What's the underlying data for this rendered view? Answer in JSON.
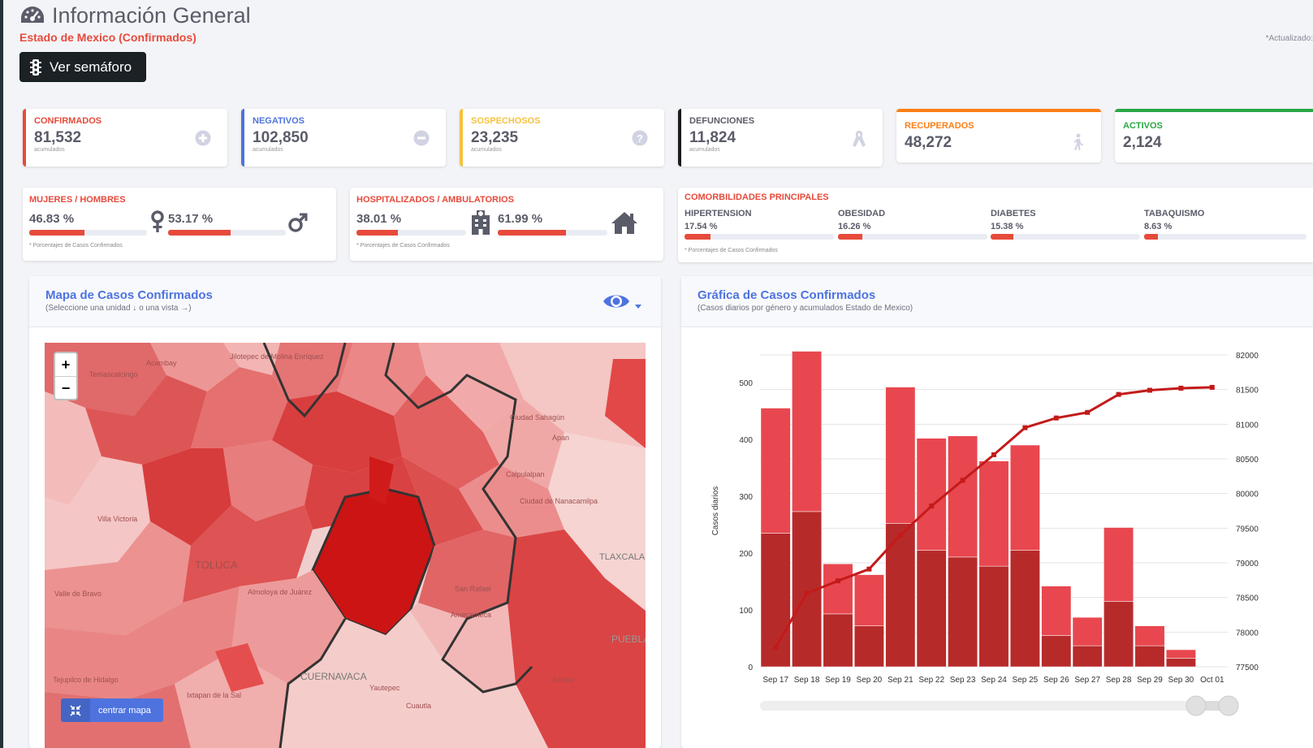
{
  "header": {
    "title": "Información General",
    "subtitle": "Estado de Mexico (Confirmados)",
    "updated_label": "*Actualizado:",
    "semaforo_button": "Ver semáforo"
  },
  "kpis": [
    {
      "label": "CONFIRMADOS",
      "value": "81,532",
      "sub": "acumulados",
      "color": "#e74a3b",
      "icon": "plus-circle-icon"
    },
    {
      "label": "NEGATIVOS",
      "value": "102,850",
      "sub": "acumulados",
      "color": "#4e73df",
      "icon": "minus-circle-icon"
    },
    {
      "label": "SOSPECHOSOS",
      "value": "23,235",
      "sub": "acumulados",
      "color": "#f6c23e",
      "icon": "question-circle-icon"
    },
    {
      "label": "DEFUNCIONES",
      "value": "11,824",
      "sub": "acumulados",
      "color": "#1b1b1b",
      "icon": "ribbon-icon"
    },
    {
      "label": "RECUPERADOS",
      "value": "48,272",
      "color": "#fd7e14",
      "icon": "walking-icon"
    },
    {
      "label": "ACTIVOS",
      "value": "2,124",
      "color": "#28a745"
    }
  ],
  "gender": {
    "title": "MUJERES / HOMBRES",
    "women_pct": "46.83 %",
    "women_fill": 0.4683,
    "men_pct": "53.17 %",
    "men_fill": 0.5317,
    "note": "* Porcentajes  de Casos Confirmados"
  },
  "hosp": {
    "title": "HOSPITALIZADOS / AMBULATORIOS",
    "hosp_pct": "38.01 %",
    "hosp_fill": 0.3801,
    "amb_pct": "61.99 %",
    "amb_fill": 0.6199,
    "note": "* Porcentajes  de Casos Confirmados"
  },
  "comorb": {
    "title": "COMORBILIDADES PRINCIPALES",
    "items": [
      {
        "label": "HIPERTENSION",
        "value": "17.54 %",
        "fill": 0.1754
      },
      {
        "label": "OBESIDAD",
        "value": "16.26 %",
        "fill": 0.1626
      },
      {
        "label": "DIABETES",
        "value": "15.38 %",
        "fill": 0.1538
      },
      {
        "label": "TABAQUISMO",
        "value": "8.63 %",
        "fill": 0.0863
      }
    ],
    "note": "* Porcentajes  de Casos Confirmados"
  },
  "map_panel": {
    "title": "Mapa de Casos Confirmados",
    "subtitle": "(Seleccione una unidad ↓ o una vista →)",
    "zoom_in": "+",
    "zoom_out": "−",
    "center_button": "centrar mapa",
    "place_labels": [
      "Acambay",
      "Jilotepec de Molina Enríquez",
      "Temascalcingo",
      "Ciudad Sahagún",
      "Apan",
      "Calpulalpan",
      "Ciudad de Nanacamilpa",
      "Villa Victoria",
      "TOLUCA",
      "TLAXCALA",
      "San Rafael",
      "Amecameca",
      "CUERNAVACA",
      "Yautepec",
      "Cuautla",
      "PUEBLA",
      "Tejupilco de Hidalgo",
      "Ixtapan de la Sal",
      "Atlixco",
      "Valle de Bravo",
      "Almoloya de Juárez"
    ]
  },
  "chart_panel": {
    "title": "Gráfica de Casos Confirmados",
    "subtitle": "(Casos diarios por género y acumulados Estado de Mexico)"
  },
  "chart_data": {
    "type": "bar",
    "categories": [
      "Sep 17",
      "Sep 18",
      "Sep 19",
      "Sep 20",
      "Sep 21",
      "Sep 22",
      "Sep 23",
      "Sep 24",
      "Sep 25",
      "Sep 26",
      "Sep 27",
      "Sep 28",
      "Sep 29",
      "Sep 30",
      "Oct 01"
    ],
    "series": [
      {
        "values": [
          235,
          273,
          93,
          72,
          252,
          205,
          193,
          177,
          205,
          55,
          37,
          115,
          37,
          15,
          0
        ],
        "color": "#b72a2a"
      },
      {
        "values": [
          220,
          282,
          88,
          90,
          240,
          197,
          213,
          185,
          185,
          87,
          50,
          130,
          35,
          15,
          0
        ],
        "color": "#e8474f"
      },
      {
        "values": [
          77780,
          78560,
          78740,
          78910,
          79400,
          79820,
          80190,
          80560,
          80950,
          81090,
          81170,
          81430,
          81490,
          81520,
          81532
        ],
        "color": "#c41a1a",
        "type": "line",
        "axis": "right"
      }
    ],
    "ylabel": "Casos diarios",
    "ylim": [
      0,
      500
    ],
    "yticks": [
      0,
      100,
      200,
      300,
      400,
      500
    ],
    "y2lim": [
      77500,
      82000
    ],
    "y2ticks": [
      77500,
      78000,
      78500,
      79000,
      79500,
      80000,
      80500,
      81000,
      81500,
      82000
    ],
    "grid": true
  }
}
